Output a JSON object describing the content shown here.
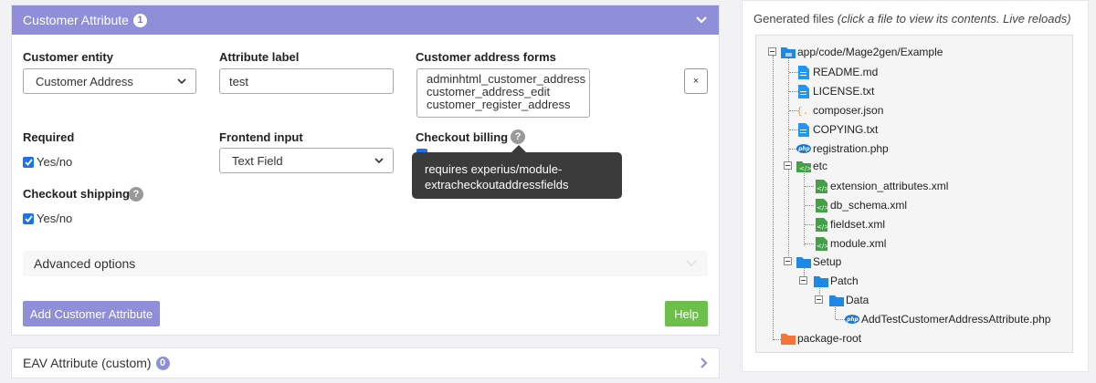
{
  "left_panel": {
    "title": "Customer Attribute",
    "badge": "1",
    "fields": {
      "entity_label": "Customer entity",
      "entity_value": "Customer Address",
      "attr_label_label": "Attribute label",
      "attr_label_value": "test",
      "address_forms_label": "Customer address forms",
      "address_forms_options": [
        "adminhtml_customer_address",
        "customer_address_edit",
        "customer_register_address"
      ],
      "clear_label": "×",
      "required_label": "Required",
      "required_checkbox": "Yes/no",
      "frontend_input_label": "Frontend input",
      "frontend_input_value": "Text Field",
      "checkout_billing_label": "Checkout billing",
      "checkout_shipping_label": "Checkout shipping",
      "checkout_shipping_checkbox": "Yes/no",
      "help_icon": "?"
    },
    "tooltip": {
      "line1": "requires experius/module-",
      "line2": "extracheckoutaddressfields"
    },
    "advanced_label": "Advanced options",
    "add_button": "Add Customer Attribute",
    "help_button": "Help"
  },
  "eav_panel": {
    "title": "EAV Attribute (custom)",
    "badge": "0"
  },
  "files_panel": {
    "heading": "Generated files",
    "heading_note": "(click a file to view its contents. Live reloads)",
    "tree": [
      {
        "label": "app/code/Mage2gen/Example",
        "icon": "folder-icon"
      },
      {
        "label": "README.md",
        "icon": "file-icon"
      },
      {
        "label": "LICENSE.txt",
        "icon": "file-icon"
      },
      {
        "label": "composer.json",
        "icon": "json-icon"
      },
      {
        "label": "COPYING.txt",
        "icon": "file-icon"
      },
      {
        "label": "registration.php",
        "icon": "php-icon"
      },
      {
        "label": "etc",
        "icon": "xml-folder-icon"
      },
      {
        "label": "extension_attributes.xml",
        "icon": "xml-icon"
      },
      {
        "label": "db_schema.xml",
        "icon": "xml-icon"
      },
      {
        "label": "fieldset.xml",
        "icon": "xml-icon"
      },
      {
        "label": "module.xml",
        "icon": "xml-icon"
      },
      {
        "label": "Setup",
        "icon": "folder-icon"
      },
      {
        "label": "Patch",
        "icon": "folder-icon"
      },
      {
        "label": "Data",
        "icon": "folder-icon"
      },
      {
        "label": "AddTestCustomerAddressAttribute.php",
        "icon": "php-icon"
      },
      {
        "label": "package-root",
        "icon": "orange-folder-icon"
      }
    ]
  },
  "colors": {
    "accent": "#8f8fd9",
    "help_green": "#6cc04a",
    "checkbox_blue": "#1a73e8",
    "tooltip_bg": "#3b3b3b"
  }
}
